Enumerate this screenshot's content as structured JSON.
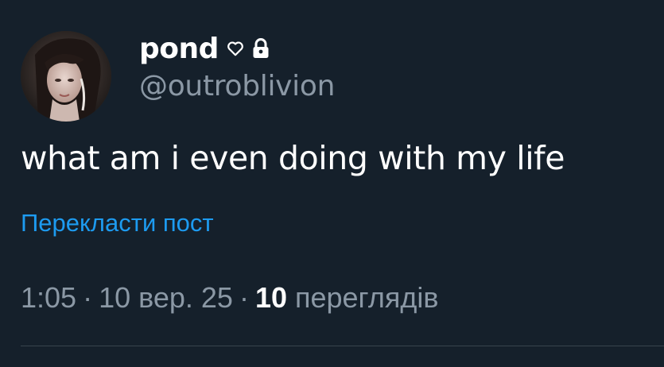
{
  "author": {
    "display_name": "pond",
    "handle": "@outroblivion",
    "heart_icon": "heart-outline-icon",
    "lock_icon": "lock-icon",
    "avatar_icon": "avatar-photo"
  },
  "tweet": {
    "text": "what am i even doing with my life",
    "translate_label": "Перекласти пост"
  },
  "meta": {
    "time": "1:05",
    "separator": "·",
    "date": "10 вер. 25",
    "views_count": "10",
    "views_label": "переглядів"
  },
  "colors": {
    "background": "#15202b",
    "text_primary": "#ffffff",
    "text_secondary": "#8b98a5",
    "link": "#1d9bf0",
    "divider": "#38444d"
  }
}
